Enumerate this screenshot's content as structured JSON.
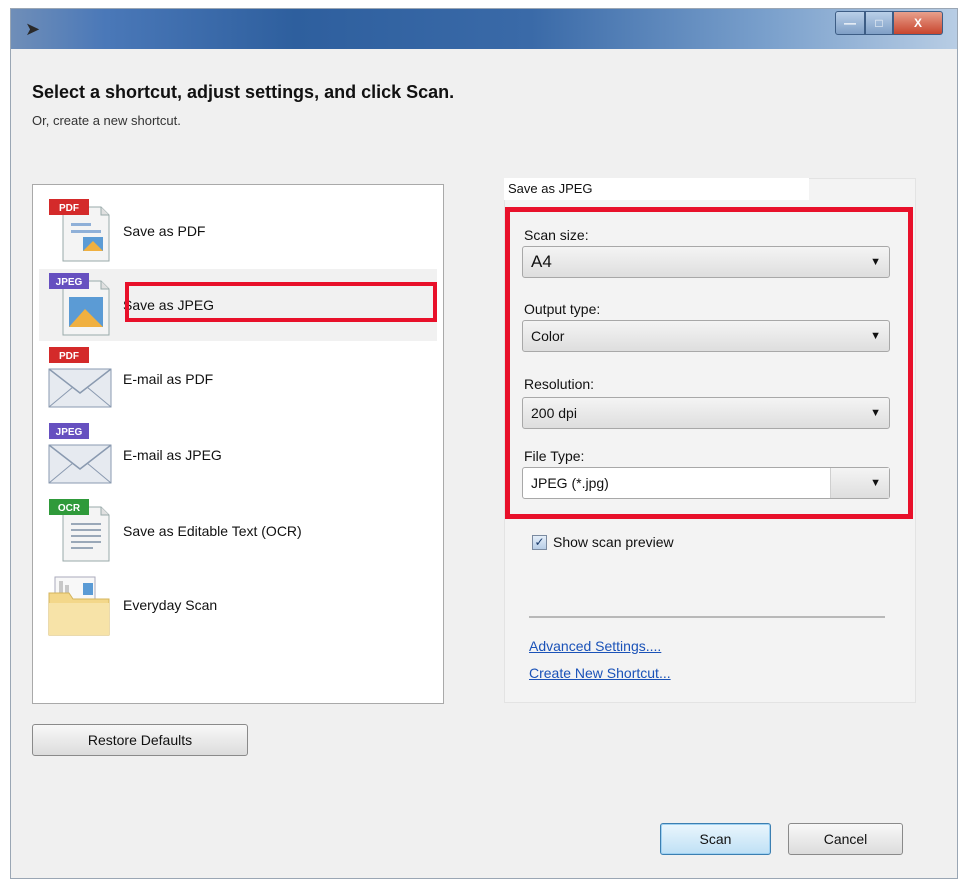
{
  "window": {
    "title_arrow": "➤",
    "controls": {
      "minimize": "—",
      "maximize": "□",
      "close": "X"
    }
  },
  "header": {
    "title": "Select a shortcut, adjust settings, and click Scan.",
    "subtitle": "Or, create a new shortcut."
  },
  "shortcuts": [
    {
      "label": "Save as PDF",
      "badge": "PDF",
      "icon": "pdf-document-icon",
      "badge_color": "#d42a2a"
    },
    {
      "label": "Save as JPEG",
      "badge": "JPEG",
      "icon": "jpeg-document-icon",
      "badge_color": "#6650c0",
      "selected": true
    },
    {
      "label": "E-mail as PDF",
      "badge": "PDF",
      "icon": "pdf-email-icon",
      "badge_color": "#d42a2a"
    },
    {
      "label": "E-mail as JPEG",
      "badge": "JPEG",
      "icon": "jpeg-email-icon",
      "badge_color": "#6650c0"
    },
    {
      "label": "Save as Editable Text (OCR)",
      "badge": "OCR",
      "icon": "ocr-document-icon",
      "badge_color": "#2f9a3a"
    },
    {
      "label": "Everyday Scan",
      "badge": "",
      "icon": "folder-icon",
      "badge_color": "#e8c86a"
    }
  ],
  "restore_defaults": "Restore Defaults",
  "settings": {
    "panel_title": "Save as JPEG",
    "scan_size": {
      "label": "Scan size:",
      "value": "A4"
    },
    "output_type": {
      "label": "Output type:",
      "value": "Color"
    },
    "resolution": {
      "label": "Resolution:",
      "value": "200 dpi"
    },
    "file_type": {
      "label": "File Type:",
      "value": "JPEG (*.jpg)"
    },
    "show_preview": {
      "label": "Show scan preview",
      "checked": true
    },
    "links": {
      "advanced": "Advanced Settings....",
      "new_shortcut": "Create New Shortcut..."
    }
  },
  "buttons": {
    "scan": "Scan",
    "cancel": "Cancel"
  },
  "colors": {
    "highlight": "#e8102a",
    "link": "#1a52b8"
  }
}
